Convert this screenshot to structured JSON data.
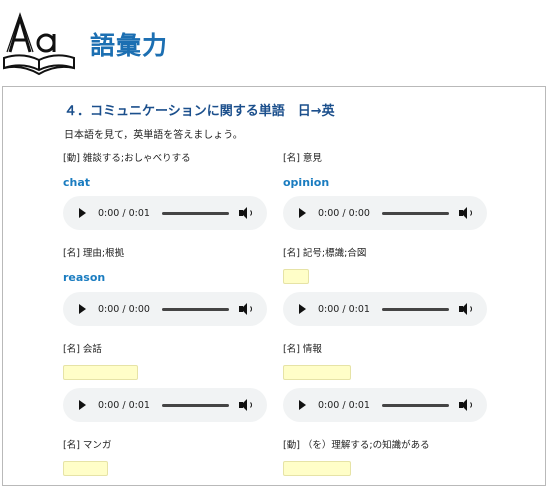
{
  "header": {
    "logo_text": "Aa",
    "title": "語彙力"
  },
  "section": {
    "title": "４．コミュニケーションに関する単語　日→英",
    "instruction": "日本語を見て，英単語を答えましょう。"
  },
  "items": [
    {
      "pos": "[動] 雑談する;おしゃべりする",
      "answer": "chat",
      "audio_time": "0:00 / 0:01"
    },
    {
      "pos": "[名] 意見",
      "answer": "opinion",
      "audio_time": "0:00 / 0:00"
    },
    {
      "pos": "[名] 理由;根拠",
      "answer": "reason",
      "audio_time": "0:00 / 0:00"
    },
    {
      "pos": "[名] 記号;標識;合図",
      "answer": "",
      "audio_time": "0:00 / 0:01"
    },
    {
      "pos": "[名] 会話",
      "answer": "",
      "audio_time": "0:00 / 0:01"
    },
    {
      "pos": "[名] 情報",
      "answer": "",
      "audio_time": "0:00 / 0:01"
    },
    {
      "pos": "[名] マンガ",
      "answer": "",
      "audio_time": ""
    },
    {
      "pos": "[動] （を）理解する;の知識がある",
      "answer": "",
      "audio_time": ""
    }
  ]
}
